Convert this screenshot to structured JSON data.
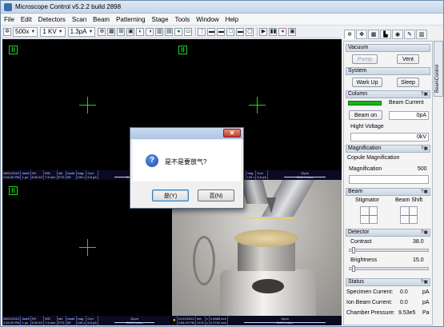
{
  "window": {
    "title": "Microscope Control v5.2.2 build 2898"
  },
  "menu": [
    "File",
    "Edit",
    "Detectors",
    "Scan",
    "Beam",
    "Patterning",
    "Stage",
    "Tools",
    "Window",
    "Help"
  ],
  "toolbar": {
    "magnification": "500x",
    "voltage": "1 KV",
    "current": "1.3pA"
  },
  "databar": {
    "q1": [
      "06/01/2013",
      "2:54:20 PM",
      "dwell",
      "1 μs",
      "HV",
      "5.00 kV",
      "WD",
      "7.5 mm",
      "det",
      "ETD",
      "mode",
      "SE",
      "mag",
      "109 x",
      "Curr",
      "5.8 pA",
      "10μm",
      "CU5-Helios"
    ],
    "q3": [
      "06/01/2013",
      "2:54:20 PM",
      "dwell",
      "1 μs",
      "HV",
      "5.00 kV",
      "WD",
      "7.5 mm",
      "det",
      "ETD",
      "mode",
      "SE",
      "mag",
      "109 x",
      "Curr",
      "5.8 pA",
      "10μm",
      "CU5-Helios"
    ],
    "q4": [
      "21/12/2013",
      "2:54:20 PM",
      "det",
      "CCD",
      "x",
      "3.4688 mm",
      "y",
      "0.2742 mm",
      "10μm",
      "CU5-Helios"
    ]
  },
  "chamber_label": "4 mm",
  "dialog": {
    "message": "是不是要放气?",
    "yes": "是(Y)",
    "no": "否(N)"
  },
  "panel": {
    "vertical_tab": "BeamControl",
    "vacuum": {
      "title": "Vacuum",
      "pump": "Pump",
      "vent": "Vent"
    },
    "system": {
      "title": "System",
      "wakeup": "Wark Up",
      "sleep": "Sleep"
    },
    "column": {
      "title": "Column",
      "help": "?▣",
      "beam_current_label": "Beam Current",
      "beam_on": "Beam on",
      "current_value": "0pA",
      "hv_label": "Hight Voltage",
      "hv_value": "0kV"
    },
    "magnification": {
      "title": "Magnification",
      "help": "?▣",
      "couple": "Copule Magnification",
      "label": "Magnification",
      "value": "500"
    },
    "beam": {
      "title": "Beam",
      "help": "?▣",
      "stigmator": "Stigmator",
      "beam_shift": "Beam Shift"
    },
    "detector": {
      "title": "Detector",
      "help": "?▣",
      "contrast_label": "Contrast",
      "contrast_value": "38.0",
      "brightness_label": "Brightness",
      "brightness_value": "15.0",
      "contrast_level": 0.03,
      "brightness_level": 0.03
    },
    "status": {
      "title": "Status",
      "help": "?▣",
      "rows": [
        {
          "label": "Specimen Current:",
          "value": "0.0",
          "unit": "pA"
        },
        {
          "label": "Ion Beam Current:",
          "value": "0.0",
          "unit": "pA"
        },
        {
          "label": "Chamber Pressure:",
          "value": "9.53e5",
          "unit": "Pa"
        }
      ]
    }
  }
}
